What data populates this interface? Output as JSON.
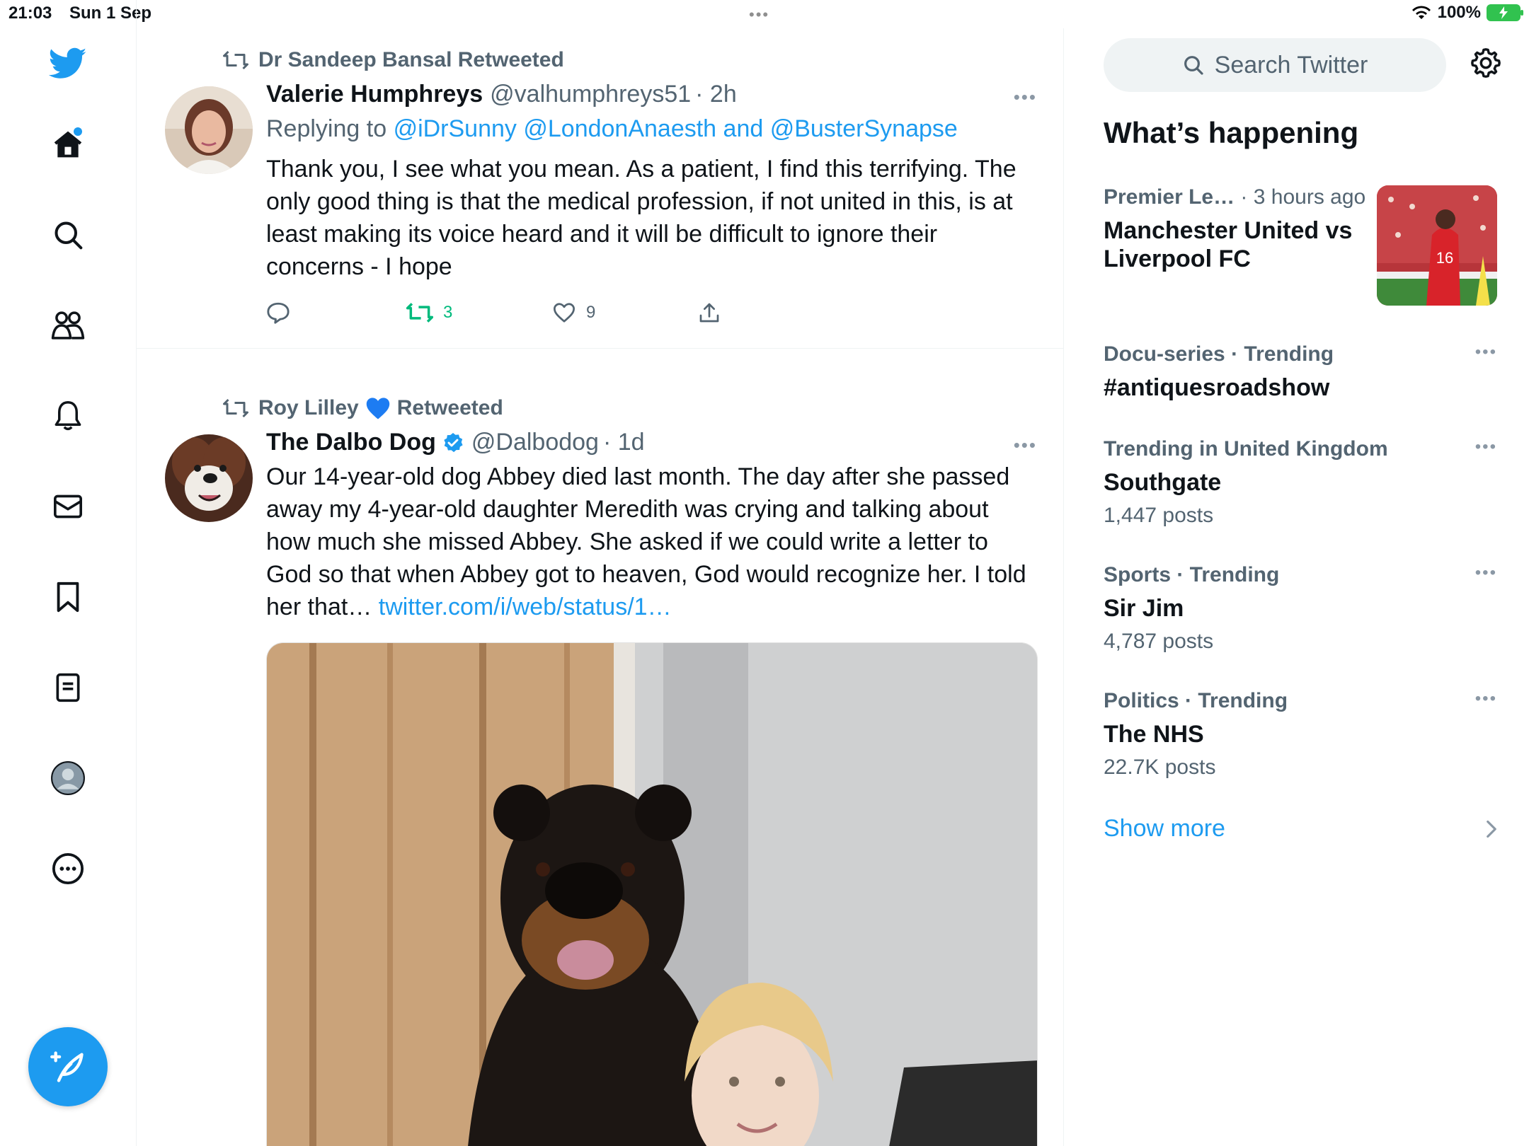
{
  "status_bar": {
    "time": "21:03",
    "date": "Sun 1 Sep",
    "battery": "100%"
  },
  "nav": {
    "icons": [
      "twitter-logo",
      "home-icon",
      "search-icon",
      "communities-icon",
      "notifications-icon",
      "messages-icon",
      "bookmarks-icon",
      "lists-icon",
      "profile-icon",
      "more-icon"
    ],
    "accent": "#1d9bf0"
  },
  "timeline": {
    "tweets": [
      {
        "retweeted_by": "Dr Sandeep Bansal Retweeted",
        "name": "Valerie Humphreys",
        "handle": "@valhumphreys51",
        "time": "· 2h",
        "reply_prefix": "Replying to",
        "reply_handles": "@iDrSunny @LondonAnaesth and @BusterSynapse",
        "text": "Thank you, I see what you mean. As a patient, I find this terrifying. The only good thing is that the medical profession, if not united in this, is at least making its voice heard and it will be difficult to ignore their concerns - I hope",
        "retweets": "3",
        "likes": "9"
      },
      {
        "retweeted_by_name": "Roy Lilley",
        "retweeted_by_suffix": "Retweeted",
        "name": "The Dalbo Dog",
        "handle": "@Dalbodog",
        "time": "· 1d",
        "text": "Our 14-year-old dog Abbey died last month. The day after she passed away my 4-year-old daughter Meredith was crying and talking about how much she missed Abbey. She asked if we could write a letter to God so that when Abbey got to heaven, God would recognize her. I told her that…",
        "link": "twitter.com/i/web/status/1…"
      }
    ]
  },
  "sidebar": {
    "search_placeholder": "Search Twitter",
    "section_title": "What’s happening",
    "trends": [
      {
        "category": "Premier Le…",
        "meta": " · 3 hours ago",
        "title": "Manchester United vs Liverpool FC"
      },
      {
        "category": "Docu-series · Trending",
        "title": "#antiquesroadshow"
      },
      {
        "category": "Trending in United Kingdom",
        "title": "Southgate",
        "count": "1,447 posts"
      },
      {
        "category": "Sports · Trending",
        "title": "Sir Jim",
        "count": "4,787 posts"
      },
      {
        "category": "Politics · Trending",
        "title": "The NHS",
        "count": "22.7K posts"
      }
    ],
    "show_more": "Show more"
  }
}
